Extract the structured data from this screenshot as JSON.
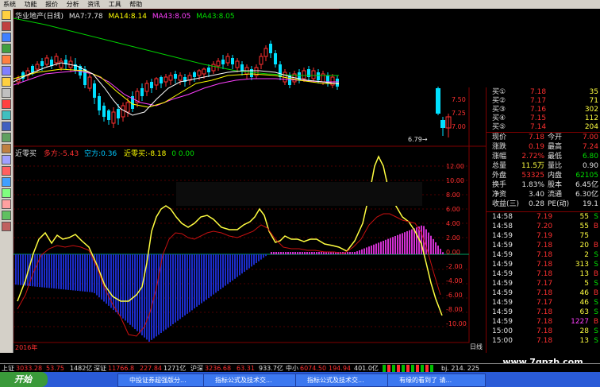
{
  "menu": [
    "系统",
    "功能",
    "报价",
    "分析",
    "资讯",
    "工具",
    "帮助"
  ],
  "chart_header": {
    "title": "华业地产(日线)",
    "ma1": "MA7:7.78",
    "ma2": "MA14:8.14",
    "ma3": "MA43:8.05",
    "ma4": "MA43:8.05"
  },
  "price_axis": [
    "7.50",
    "7.25",
    "7.00"
  ],
  "low_marker": "6.79",
  "indicator_header": {
    "name": "近零买",
    "duo": "多方:-5.43",
    "kong": "空方:0.36",
    "jin": "近零买:-8.18",
    "zero": "0  0.00"
  },
  "indicator_axis": [
    "12.00",
    "10.00",
    "8.00",
    "6.00",
    "4.00",
    "2.00",
    "0.00",
    "-2.00",
    "-4.00",
    "-6.00",
    "-8.00",
    "-10.00"
  ],
  "x_label": "2016年",
  "period_label": "日线",
  "quote": {
    "buy_rows": [
      {
        "label": "买①",
        "price": "7.18",
        "vol": "35"
      },
      {
        "label": "买②",
        "price": "7.17",
        "vol": "71"
      },
      {
        "label": "买③",
        "price": "7.16",
        "vol": "302"
      },
      {
        "label": "买④",
        "price": "7.15",
        "vol": "112"
      },
      {
        "label": "买⑤",
        "price": "7.14",
        "vol": "204"
      }
    ],
    "stats": [
      {
        "l1": "现价",
        "v1": "7.18",
        "l2": "今开",
        "v2": "7.00"
      },
      {
        "l1": "涨跌",
        "v1": "0.19",
        "l2": "最高",
        "v2": "7.24"
      },
      {
        "l1": "涨幅",
        "v1": "2.72%",
        "l2": "最低",
        "v2": "6.80"
      },
      {
        "l1": "总量",
        "v1": "11.5万",
        "l2": "量比",
        "v2": "0.90"
      },
      {
        "l1": "外盘",
        "v1": "53325",
        "l2": "内盘",
        "v2": "62105"
      },
      {
        "l1": "换手",
        "v1": "1.83%",
        "l2": "股本",
        "v2": "6.45亿"
      },
      {
        "l1": "净资",
        "v1": "3.40",
        "l2": "流通",
        "v2": "6.30亿"
      },
      {
        "l1": "收益(三)",
        "v1": "0.28",
        "l2": "PE(动)",
        "v2": "19.1"
      }
    ],
    "ticks": [
      {
        "t": "14:58",
        "p": "7.19",
        "v": "55",
        "f": "S"
      },
      {
        "t": "14:58",
        "p": "7.20",
        "v": "55",
        "f": "B"
      },
      {
        "t": "14:59",
        "p": "7.19",
        "v": "75",
        "f": ""
      },
      {
        "t": "14:59",
        "p": "7.18",
        "v": "20",
        "f": "B"
      },
      {
        "t": "14:59",
        "p": "7.18",
        "v": "2",
        "f": "S"
      },
      {
        "t": "14:59",
        "p": "7.18",
        "v": "313",
        "f": "S"
      },
      {
        "t": "14:59",
        "p": "7.18",
        "v": "13",
        "f": "B"
      },
      {
        "t": "14:59",
        "p": "7.17",
        "v": "5",
        "f": "S"
      },
      {
        "t": "14:59",
        "p": "7.18",
        "v": "46",
        "f": "B"
      },
      {
        "t": "14:59",
        "p": "7.17",
        "v": "46",
        "f": "S"
      },
      {
        "t": "14:59",
        "p": "7.18",
        "v": "63",
        "f": "S"
      },
      {
        "t": "14:59",
        "p": "7.18",
        "v": "1227",
        "f": "B"
      },
      {
        "t": "15:00",
        "p": "7.18",
        "v": "28",
        "f": "S"
      },
      {
        "t": "15:00",
        "p": "7.18",
        "v": "13",
        "f": "S"
      }
    ]
  },
  "status_bar": {
    "sh_label": "上证",
    "sh_val": "3033.28",
    "sh_chg": "53.75",
    "sh_amt": "1482亿",
    "sz_label": "深证",
    "sz_val": "11766.8",
    "sz_chg": "227.84",
    "sz_amt": "1271亿",
    "hs_label": "沪深",
    "hs_val": "3236.68",
    "hs_chg": "63.31",
    "hs_amt": "933.7亿",
    "zx_label": "中小",
    "zx_val": "6074.50",
    "zx_chg": "194.94",
    "zx_amt": "401.0亿",
    "right_text": "bj. 214. 225"
  },
  "taskbar": {
    "start": "开始",
    "tasks": [
      "中投证券超强版分...",
      "指标公式及技术交...",
      "指标公式及技术交...",
      "有缘的看到了 请..."
    ]
  },
  "watermark": "www.7gpzb.com",
  "colors": {
    "up": "#ff3030",
    "down": "#00e0ff",
    "ma7": "#ffffff",
    "ma14": "#ffff00",
    "ma43": "#ff40ff",
    "ma_long": "#00d000",
    "kong_bar": "#1c2cc8",
    "duo_bar": "#d030d0",
    "line_yellow": "#ffff40",
    "line_red": "#d01010"
  }
}
